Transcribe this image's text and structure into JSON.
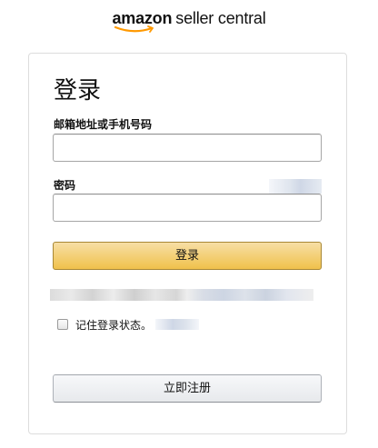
{
  "header": {
    "logo_brand": "amazon",
    "logo_rest": "seller central"
  },
  "form": {
    "title": "登录",
    "email_label": "邮箱地址或手机号码",
    "email_value": "",
    "password_label": "密码",
    "password_value": "",
    "signin_button": "登录",
    "remember_label": "记住登录状态。",
    "register_button": "立即注册"
  },
  "colors": {
    "primary_button": "#f0c14b",
    "primary_border": "#a88734",
    "logo_smile": "#ff9900",
    "card_border": "#dddddd"
  },
  "icons": {
    "logo": "amazon-smile-icon"
  }
}
